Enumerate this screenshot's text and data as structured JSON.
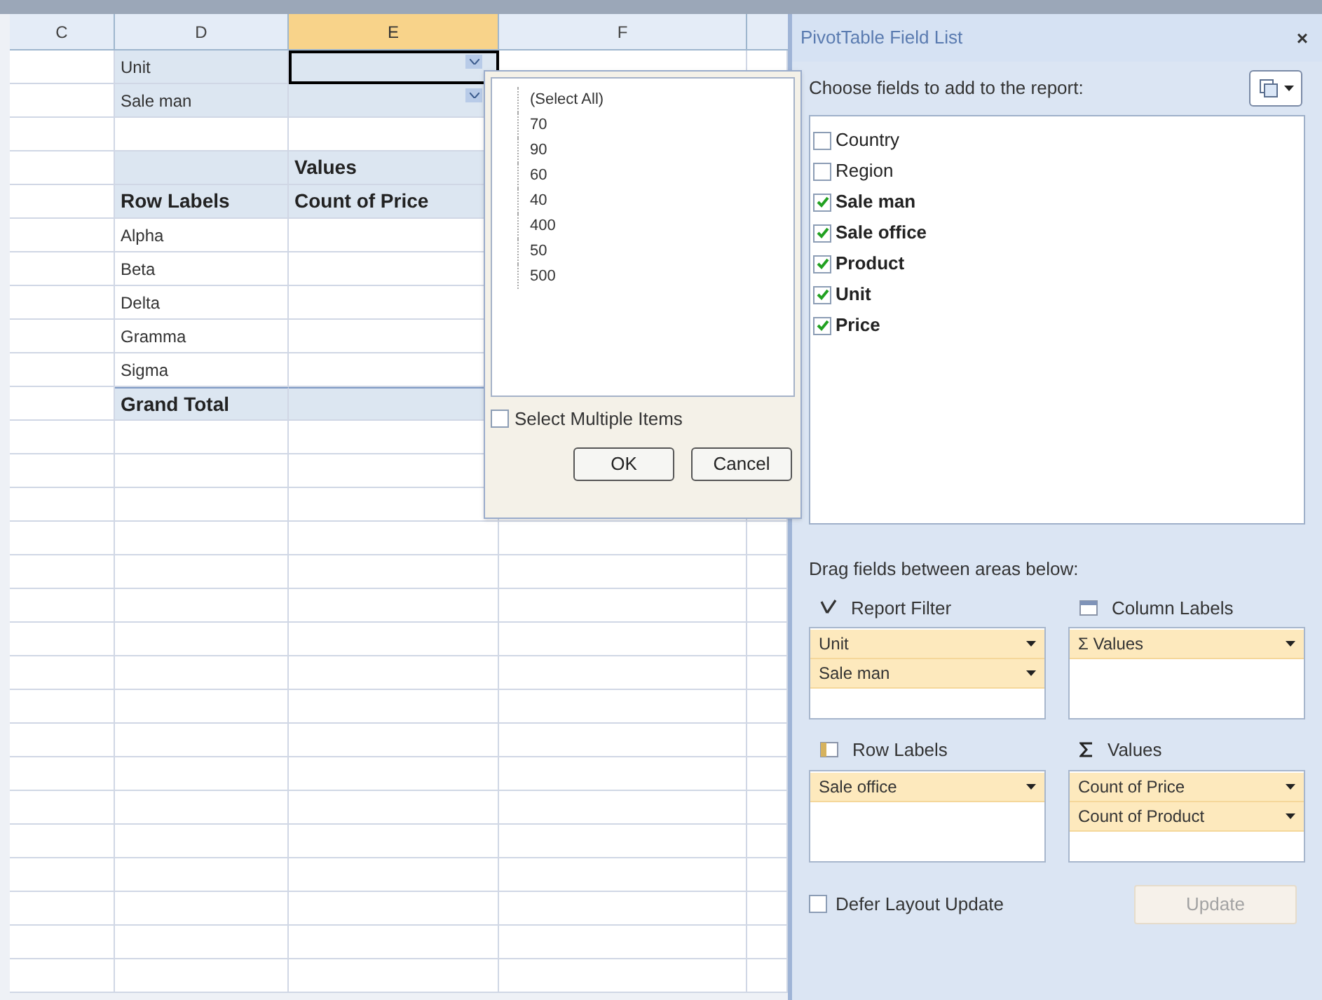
{
  "sheet": {
    "columns": [
      {
        "label": "C",
        "selected": false
      },
      {
        "label": "D",
        "selected": false
      },
      {
        "label": "E",
        "selected": true
      },
      {
        "label": "F",
        "selected": false
      }
    ],
    "filters": [
      {
        "label": "Unit",
        "selected": true
      },
      {
        "label": "Sale man",
        "selected": false
      }
    ],
    "values_header": "Values",
    "row_labels_header": "Row Labels",
    "count_header": "Count of Price",
    "rows": [
      "Alpha",
      "Beta",
      "Delta",
      "Gramma",
      "Sigma"
    ],
    "grand_total": "Grand Total"
  },
  "filter_popup": {
    "items": [
      "(Select All)",
      "70",
      "90",
      "60",
      "40",
      "400",
      "50",
      "500"
    ],
    "select_multiple": {
      "label": "Select Multiple Items",
      "checked": false
    },
    "buttons": [
      "OK",
      "Cancel"
    ]
  },
  "field_list": {
    "title": "PivotTable Field List",
    "close": "×",
    "prompt": "Choose fields to add to the report:",
    "fields": [
      {
        "label": "Country",
        "checked": false
      },
      {
        "label": "Region",
        "checked": false
      },
      {
        "label": "Sale man",
        "checked": true
      },
      {
        "label": "Sale office",
        "checked": true
      },
      {
        "label": "Product",
        "checked": true
      },
      {
        "label": "Unit",
        "checked": true
      },
      {
        "label": "Price",
        "checked": true
      }
    ],
    "drag_prompt": "Drag fields between areas below:",
    "areas": [
      {
        "kind": "filter",
        "title": "Report Filter",
        "items": [
          "Unit",
          "Sale man"
        ]
      },
      {
        "kind": "columns",
        "title": "Column Labels",
        "items": [
          "Σ Values"
        ]
      },
      {
        "kind": "rows",
        "title": "Row Labels",
        "items": [
          "Sale office"
        ]
      },
      {
        "kind": "values",
        "title": "Values",
        "items": [
          "Count of Price",
          "Count of Product"
        ]
      }
    ],
    "defer": {
      "label": "Defer Layout Update",
      "checked": false
    },
    "update_button": {
      "label": "Update",
      "disabled": true
    }
  }
}
